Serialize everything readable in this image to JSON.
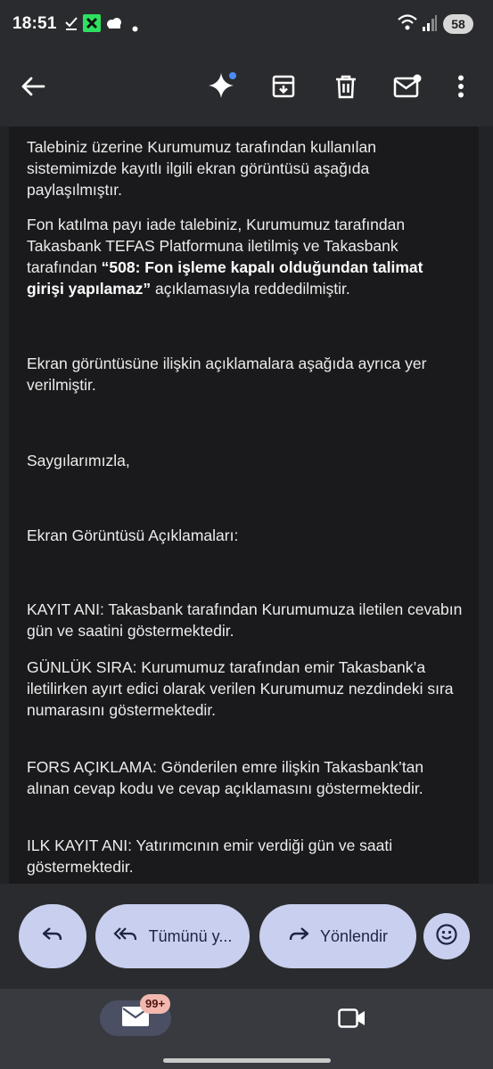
{
  "status_bar": {
    "time": "18:51",
    "battery": "58",
    "notification_icons": [
      "download-done-icon",
      "app-x-icon",
      "cloud-icon",
      "dot-icon"
    ],
    "system_icons": [
      "wifi-icon",
      "signal-icon"
    ]
  },
  "app_bar": {
    "icons": [
      "back-arrow-icon",
      "sparkle-icon",
      "archive-icon",
      "trash-icon",
      "mark-unread-icon",
      "more-vert-icon"
    ]
  },
  "email": {
    "paragraph1": "Talebiniz üzerine Kurumumuz tarafından kullanılan sistemimizde kayıtlı ilgili ekran görüntüsü aşağıda paylaşılmıştır.",
    "paragraph2_before": "Fon katılma payı iade talebiniz, Kurumumuz tarafından Takasbank TEFAS Platformuna iletilmiş ve Takasbank tarafından ",
    "paragraph2_bold": "“508: Fon işleme kapalı olduğundan talimat girişi yapılamaz”",
    "paragraph2_after": " açıklamasıyla reddedilmiştir.",
    "paragraph3": "Ekran görüntüsüne ilişkin açıklamalara aşağıda ayrıca yer verilmiştir.",
    "closing": "Saygılarımızla,",
    "section_title": "Ekran Görüntüsü Açıklamaları:",
    "item1": "KAYIT ANI: Takasbank tarafından Kurumumuza iletilen cevabın gün ve saatini göstermektedir.",
    "item2": "GÜNLÜK SIRA: Kurumumuz tarafından emir Takasbank’a iletilirken ayırt edici olarak verilen Kurumumuz nezdindeki sıra numarasını göstermektedir.",
    "item3": "FORS AÇIKLAMA: Gönderilen emre ilişkin Takasbank’tan alınan cevap kodu ve cevap açıklamasını göstermektedir.",
    "item4": "ILK KAYIT ANI: Yatırımcının emir verdiği gün ve saati göstermektedir."
  },
  "actions": {
    "reply_icon": "reply-icon",
    "reply_all_label": "Tümünü y...",
    "forward_label": "Yönlendir",
    "emoji_icon": "emoji-icon"
  },
  "bottom_nav": {
    "mail_badge": "99+",
    "icons": [
      "mail-icon",
      "video-icon"
    ]
  },
  "colors": {
    "background": "#222326",
    "email_body": "#1a1a1c",
    "pill": "#c9cfee",
    "badge": "#f2b7ae",
    "sparkle_dot": "#4a8cff"
  }
}
